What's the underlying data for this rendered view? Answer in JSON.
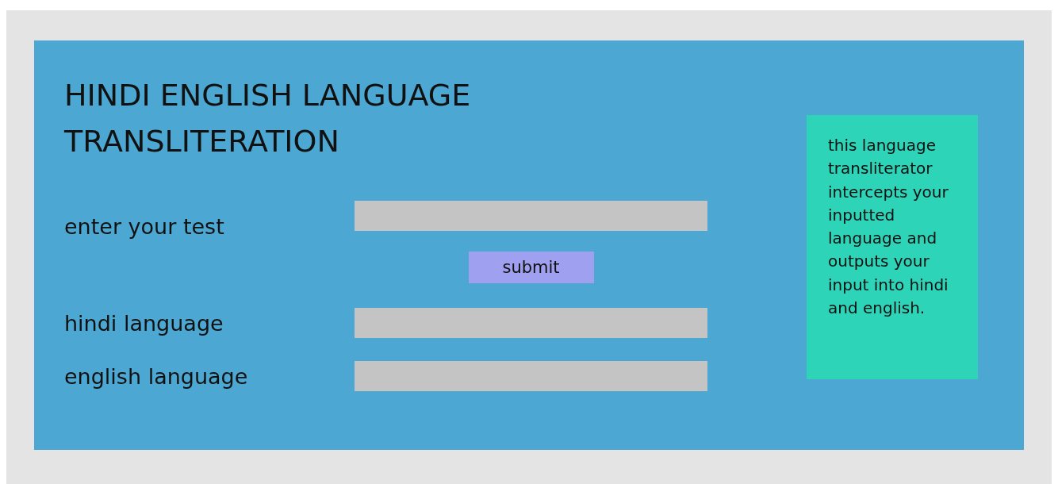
{
  "title": "HINDI ENGLISH LANGUAGE TRANSLITERATION",
  "fields": [
    {
      "label": "enter your test"
    },
    {
      "label": "hindi language"
    },
    {
      "label": "english language"
    }
  ],
  "submit_button": "submit",
  "info_box": "this language transliterator intercepts your inputted language and outputs your input into hindi and english."
}
